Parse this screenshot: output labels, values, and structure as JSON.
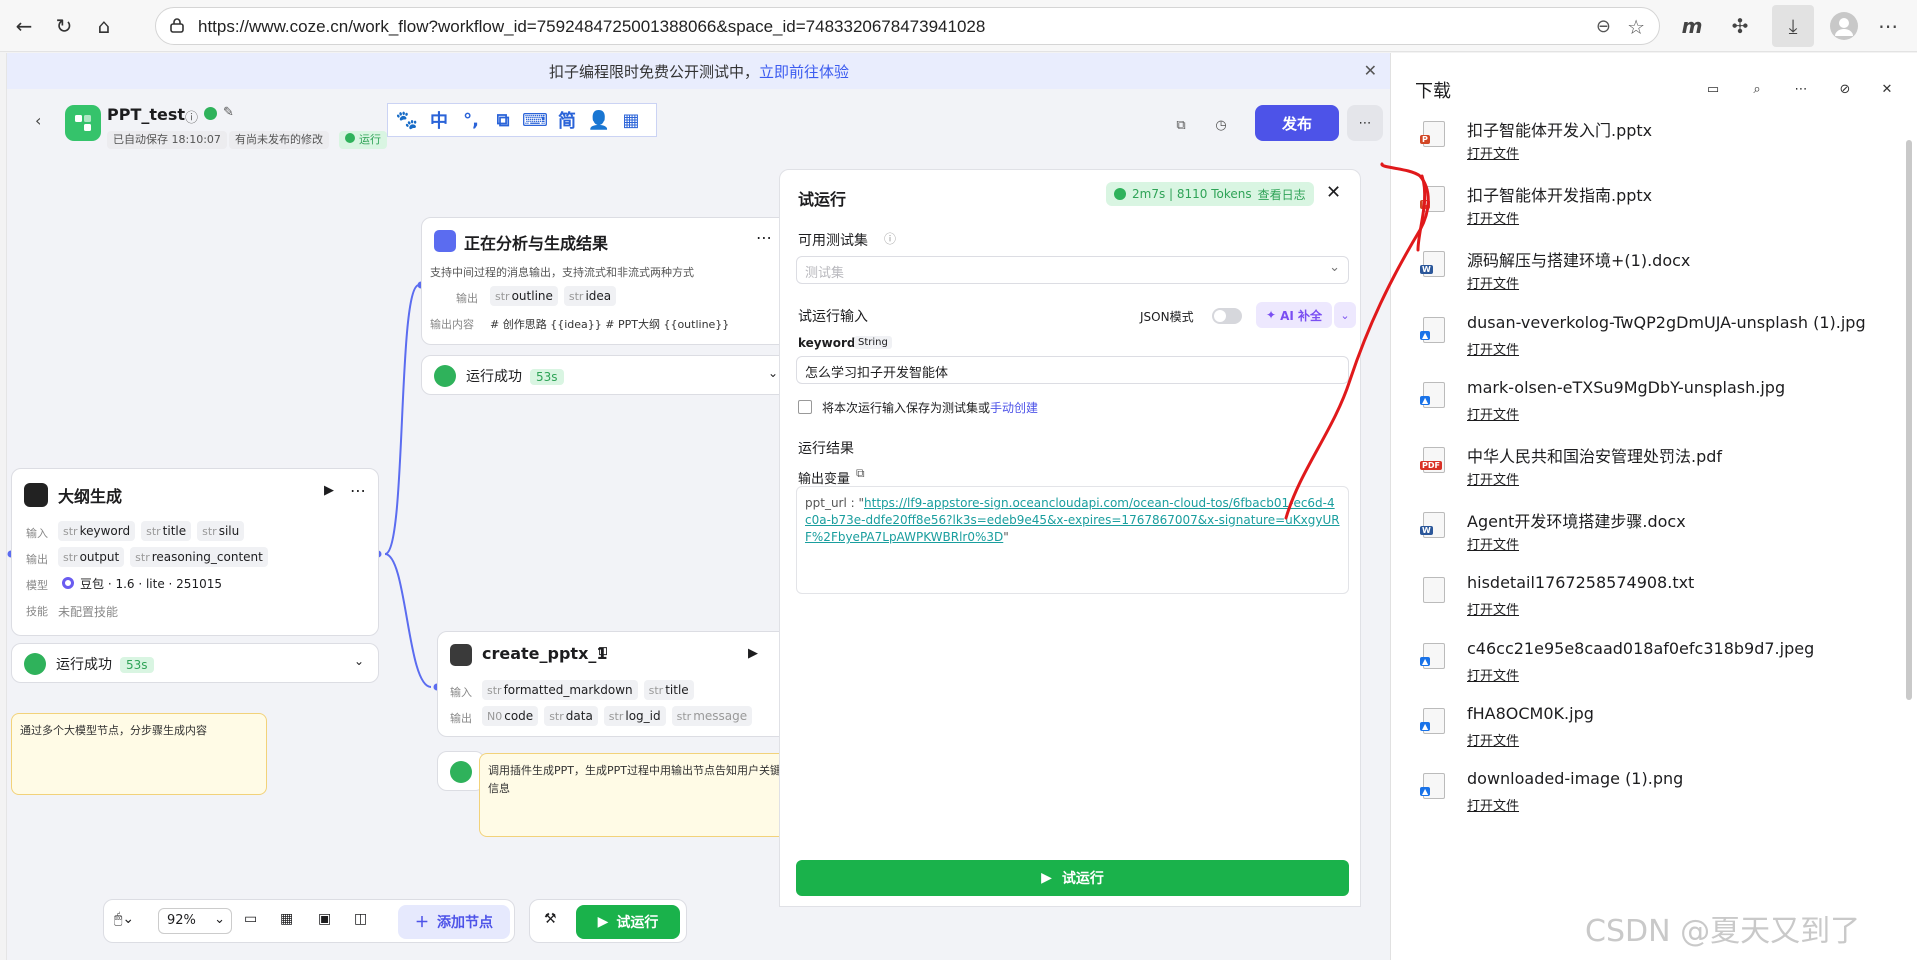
{
  "browser": {
    "url": "https://www.coze.cn/work_flow?workflow_id=7592484725001388066&space_id=7483320678473941028"
  },
  "banner": {
    "text": "扣子编程限时免费公开测试中，",
    "link": "立即前往体验"
  },
  "project": {
    "title": "PPT_test",
    "saved": "已自动保存 18:10:07",
    "unpublished": "有尚未发布的修改",
    "run_status": "运行",
    "publish": "发布"
  },
  "ime": [
    "🐾",
    "中",
    "°,",
    "⧉",
    "⌨",
    "简",
    "👤",
    "▦"
  ],
  "nodes": {
    "analyze": {
      "title": "正在分析与生成结果",
      "desc": "支持中间过程的消息输出，支持流式和非流式两种方式",
      "out_label": "输出",
      "outputs": [
        "outline",
        "idea"
      ],
      "content_label": "输出内容",
      "content": "# 创作思路 {{idea}} # PPT大纲 {{outline}}",
      "status": "运行成功",
      "time": "53s"
    },
    "outline": {
      "title": "大纲生成",
      "in_label": "输入",
      "inputs": [
        "keyword",
        "title",
        "silu"
      ],
      "out_label": "输出",
      "outputs": [
        "output",
        "reasoning_content"
      ],
      "model_label": "模型",
      "model": "豆包 · 1.6 · lite · 251015",
      "skill_label": "技能",
      "skill": "未配置技能",
      "status": "运行成功",
      "time": "53s"
    },
    "create_pptx": {
      "title": "create_pptx_1",
      "in_label": "输入",
      "inputs": [
        "formatted_markdown",
        "title"
      ],
      "out_label": "输出",
      "outputs": [
        "code",
        "data",
        "log_id",
        "message"
      ],
      "note": "调用插件生成PPT，生成PPT过程中用输出节点告知用户关键信息"
    },
    "note_outline": "通过多个大模型节点，分步骤生成内容",
    "type_str": "str",
    "type_num": "N0"
  },
  "toolbar": {
    "zoom": "92%",
    "add_node": "添加节点",
    "run": "试运行"
  },
  "panel": {
    "title": "试运行",
    "stats": "2m7s | 8110 Tokens",
    "view_log": "查看日志",
    "testset_label": "可用测试集",
    "testset_ph": "测试集",
    "input_label": "试运行输入",
    "json_mode": "JSON模式",
    "ai_fill": "AI 补全",
    "field_name": "keyword",
    "field_type": "String",
    "field_value": "怎么学习扣子开发智能体",
    "save_text": "将本次运行输入保存为测试集或",
    "manual_create": "手动创建",
    "result_label": "运行结果",
    "output_var": "输出变量",
    "ppt_key": "ppt_url : ",
    "ppt_url": "https://lf9-appstore-sign.oceancloudapi.com/ocean-cloud-tos/6fbacb01-ec6d-4c0a-b73e-ddfe20ff8e56?lk3s=edeb9e45&x-expires=1767867007&x-signature=uKxgyURF%2FbyePA7LpAWPKWBRlr0%3D",
    "run_btn": "试运行"
  },
  "downloads": {
    "title": "下载",
    "open": "打开文件",
    "items": [
      {
        "name": "扣子智能体开发入门.pptx",
        "type": "pptx"
      },
      {
        "name": "扣子智能体开发指南.pptx",
        "type": "pptx"
      },
      {
        "name": "源码解压与搭建环境+(1).docx",
        "type": "docx"
      },
      {
        "name": "dusan-veverkolog-TwQP2gDmUJA-unsplash (1).jpg",
        "type": "img"
      },
      {
        "name": "mark-olsen-eTXSu9MgDbY-unsplash.jpg",
        "type": "img"
      },
      {
        "name": "中华人民共和国治安管理处罚法.pdf",
        "type": "pdf"
      },
      {
        "name": "Agent开发环境搭建步骤.docx",
        "type": "docx"
      },
      {
        "name": "hisdetail1767258574908.txt",
        "type": "txt"
      },
      {
        "name": "c46cc21e95e8caad018af0efc318b9d7.jpeg",
        "type": "img"
      },
      {
        "name": "fHA8OCM0K.jpg",
        "type": "img"
      },
      {
        "name": "downloaded-image (1).png",
        "type": "img"
      }
    ],
    "colors": {
      "pptx": "#d24726",
      "docx": "#2b579a",
      "pdf": "#d93025",
      "img": "#1a73e8",
      "txt": "#888888"
    },
    "labels": {
      "pptx": "P",
      "docx": "W",
      "pdf": "PDF",
      "img": "▲",
      "txt": ""
    }
  },
  "watermark": "CSDN @夏天又到了"
}
